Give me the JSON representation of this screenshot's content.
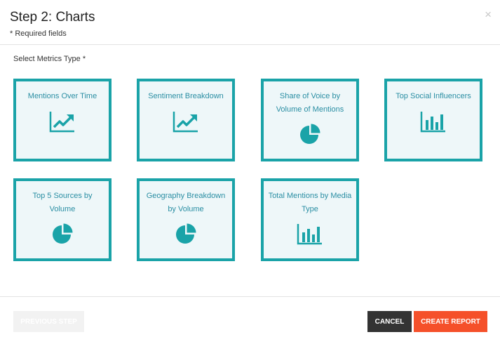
{
  "dialog": {
    "title": "Step 2: Charts",
    "required_note": "* Required fields",
    "close_glyph": "×"
  },
  "metrics": {
    "label": "Select Metrics Type *",
    "options": [
      {
        "label": "Mentions Over Time",
        "icon": "line-trend-icon"
      },
      {
        "label": "Sentiment Breakdown",
        "icon": "line-trend-icon"
      },
      {
        "label": "Share of Voice by Volume of Mentions",
        "icon": "pie-chart-icon"
      },
      {
        "label": "Top Social Influencers",
        "icon": "bar-chart-icon"
      },
      {
        "label": "Top 5 Sources by Volume",
        "icon": "pie-chart-icon"
      },
      {
        "label": "Geography Breakdown by Volume",
        "icon": "pie-chart-icon"
      },
      {
        "label": "Total Mentions by Media Type",
        "icon": "bar-chart-icon"
      }
    ]
  },
  "footer": {
    "previous_label": "PREVIOUS STEP",
    "cancel_label": "CANCEL",
    "create_label": "CREATE REPORT"
  },
  "colors": {
    "accent": "#1aa3a8",
    "card_bg": "#eef7f9",
    "label_text": "#2a8ea3",
    "create_button": "#f5502a",
    "cancel_button": "#333333"
  }
}
